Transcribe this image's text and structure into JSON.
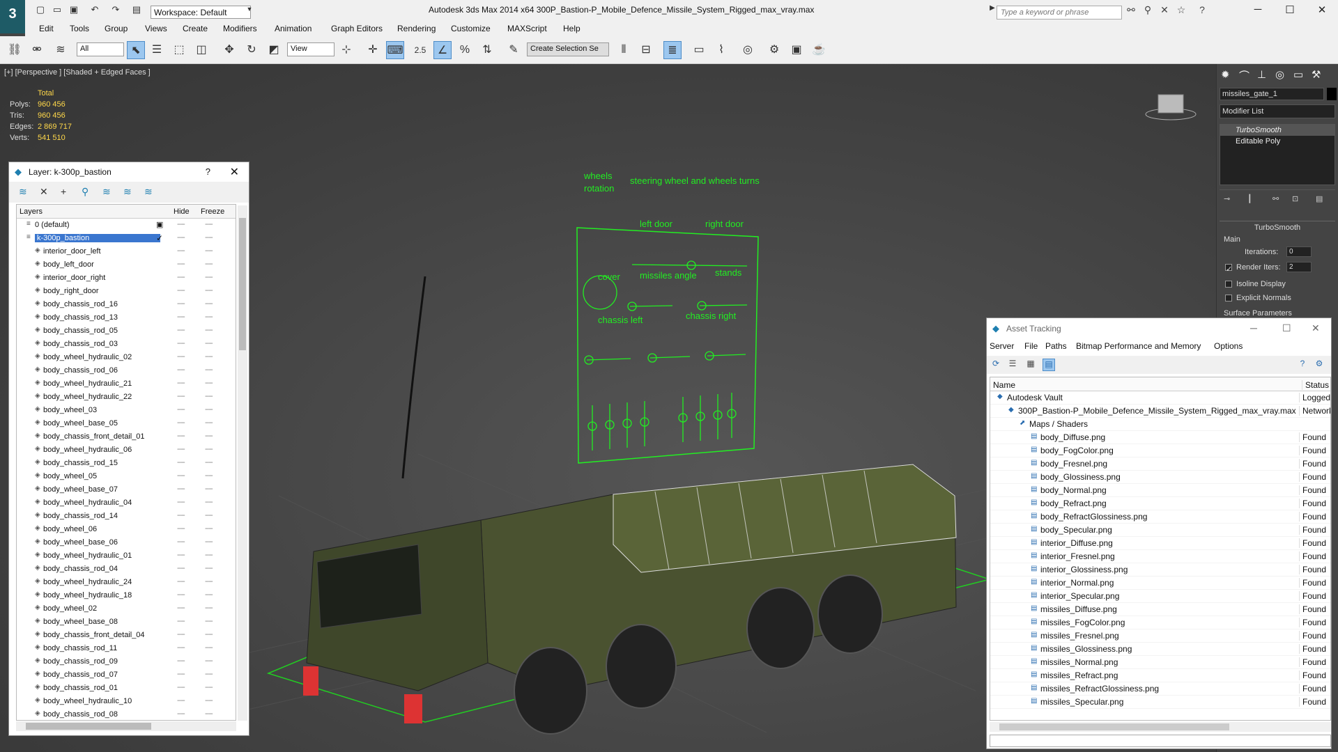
{
  "app": {
    "logo": "3",
    "title": "Autodesk 3ds Max  2014 x64     300P_Bastion-P_Mobile_Defence_Missile_System_Rigged_max_vray.max",
    "workspace": "Workspace: Default",
    "search_placeholder": "Type a keyword or phrase"
  },
  "menu": [
    "Edit",
    "Tools",
    "Group",
    "Views",
    "Create",
    "Modifiers",
    "Animation",
    "Graph Editors",
    "Rendering",
    "Customize",
    "MAXScript",
    "Help"
  ],
  "toolbar": {
    "filter": "All",
    "ref_coord": "View",
    "snap_label": "2.5",
    "named_sel": "Create Selection Se"
  },
  "viewport": {
    "label": "[+] [Perspective ] [Shaded + Edged Faces ]",
    "stats": {
      "header": "Total",
      "rows": [
        {
          "label": "Polys:",
          "value": "960 456"
        },
        {
          "label": "Tris:",
          "value": "960 456"
        },
        {
          "label": "Edges:",
          "value": "2 869 717"
        },
        {
          "label": "Verts:",
          "value": "541 510"
        }
      ]
    },
    "panel_labels": {
      "wheels_rotation": "wheels rotation",
      "steering": "steering wheel and wheels turns",
      "left_door": "left door",
      "right_door": "right door",
      "cover": "cover",
      "missiles_angle": "missiles angle",
      "stands": "stands",
      "chassis_left": "chassis left",
      "chassis_right": "chassis right"
    }
  },
  "layer_window": {
    "title": "Layer: k-300p_bastion",
    "help": "?",
    "col_layers": "Layers",
    "col_hide": "Hide",
    "col_freeze": "Freeze",
    "rows": [
      {
        "name": "0 (default)",
        "level": 0
      },
      {
        "name": "k-300p_bastion",
        "level": 0,
        "selected": true
      },
      {
        "name": "interior_door_left",
        "level": 1
      },
      {
        "name": "body_left_door",
        "level": 1
      },
      {
        "name": "interior_door_right",
        "level": 1
      },
      {
        "name": "body_right_door",
        "level": 1
      },
      {
        "name": "body_chassis_rod_16",
        "level": 1
      },
      {
        "name": "body_chassis_rod_13",
        "level": 1
      },
      {
        "name": "body_chassis_rod_05",
        "level": 1
      },
      {
        "name": "body_chassis_rod_03",
        "level": 1
      },
      {
        "name": "body_wheel_hydraulic_02",
        "level": 1
      },
      {
        "name": "body_chassis_rod_06",
        "level": 1
      },
      {
        "name": "body_wheel_hydraulic_21",
        "level": 1
      },
      {
        "name": "body_wheel_hydraulic_22",
        "level": 1
      },
      {
        "name": "body_wheel_03",
        "level": 1
      },
      {
        "name": "body_wheel_base_05",
        "level": 1
      },
      {
        "name": "body_chassis_front_detail_01",
        "level": 1
      },
      {
        "name": "body_wheel_hydraulic_06",
        "level": 1
      },
      {
        "name": "body_chassis_rod_15",
        "level": 1
      },
      {
        "name": "body_wheel_05",
        "level": 1
      },
      {
        "name": "body_wheel_base_07",
        "level": 1
      },
      {
        "name": "body_wheel_hydraulic_04",
        "level": 1
      },
      {
        "name": "body_chassis_rod_14",
        "level": 1
      },
      {
        "name": "body_wheel_06",
        "level": 1
      },
      {
        "name": "body_wheel_base_06",
        "level": 1
      },
      {
        "name": "body_wheel_hydraulic_01",
        "level": 1
      },
      {
        "name": "body_chassis_rod_04",
        "level": 1
      },
      {
        "name": "body_wheel_hydraulic_24",
        "level": 1
      },
      {
        "name": "body_wheel_hydraulic_18",
        "level": 1
      },
      {
        "name": "body_wheel_02",
        "level": 1
      },
      {
        "name": "body_wheel_base_08",
        "level": 1
      },
      {
        "name": "body_chassis_front_detail_04",
        "level": 1
      },
      {
        "name": "body_chassis_rod_11",
        "level": 1
      },
      {
        "name": "body_chassis_rod_09",
        "level": 1
      },
      {
        "name": "body_chassis_rod_07",
        "level": 1
      },
      {
        "name": "body_chassis_rod_01",
        "level": 1
      },
      {
        "name": "body_wheel_hydraulic_10",
        "level": 1
      },
      {
        "name": "body_chassis_rod_08",
        "level": 1
      }
    ]
  },
  "command_panel": {
    "object_name": "missiles_gate_1",
    "modifier_list": "Modifier List",
    "stack": [
      "TurboSmooth",
      "Editable Poly"
    ],
    "rollout": "TurboSmooth",
    "group_main": "Main",
    "iterations_label": "Iterations:",
    "iterations": "0",
    "render_iters_label": "Render Iters:",
    "render_iters": "2",
    "isoline": "Isoline Display",
    "explicit": "Explicit Normals",
    "surface": "Surface Parameters"
  },
  "asset_window": {
    "title": "Asset Tracking",
    "menu": [
      "Server",
      "File",
      "Paths",
      "Bitmap Performance and Memory",
      "Options"
    ],
    "col_name": "Name",
    "col_status": "Status",
    "rows": [
      {
        "name": "Autodesk Vault",
        "status": "Logged Out",
        "level": 0
      },
      {
        "name": "300P_Bastion-P_Mobile_Defence_Missile_System_Rigged_max_vray.max",
        "status": "Network",
        "level": 1
      },
      {
        "name": "Maps / Shaders",
        "status": "",
        "level": 2
      },
      {
        "name": "body_Diffuse.png",
        "status": "Found",
        "level": 3
      },
      {
        "name": "body_FogColor.png",
        "status": "Found",
        "level": 3
      },
      {
        "name": "body_Fresnel.png",
        "status": "Found",
        "level": 3
      },
      {
        "name": "body_Glossiness.png",
        "status": "Found",
        "level": 3
      },
      {
        "name": "body_Normal.png",
        "status": "Found",
        "level": 3
      },
      {
        "name": "body_Refract.png",
        "status": "Found",
        "level": 3
      },
      {
        "name": "body_RefractGlossiness.png",
        "status": "Found",
        "level": 3
      },
      {
        "name": "body_Specular.png",
        "status": "Found",
        "level": 3
      },
      {
        "name": "interior_Diffuse.png",
        "status": "Found",
        "level": 3
      },
      {
        "name": "interior_Fresnel.png",
        "status": "Found",
        "level": 3
      },
      {
        "name": "interior_Glossiness.png",
        "status": "Found",
        "level": 3
      },
      {
        "name": "interior_Normal.png",
        "status": "Found",
        "level": 3
      },
      {
        "name": "interior_Specular.png",
        "status": "Found",
        "level": 3
      },
      {
        "name": "missiles_Diffuse.png",
        "status": "Found",
        "level": 3
      },
      {
        "name": "missiles_FogColor.png",
        "status": "Found",
        "level": 3
      },
      {
        "name": "missiles_Fresnel.png",
        "status": "Found",
        "level": 3
      },
      {
        "name": "missiles_Glossiness.png",
        "status": "Found",
        "level": 3
      },
      {
        "name": "missiles_Normal.png",
        "status": "Found",
        "level": 3
      },
      {
        "name": "missiles_Refract.png",
        "status": "Found",
        "level": 3
      },
      {
        "name": "missiles_RefractGlossiness.png",
        "status": "Found",
        "level": 3
      },
      {
        "name": "missiles_Specular.png",
        "status": "Found",
        "level": 3
      }
    ]
  },
  "colors": {
    "rig_green": "#22ee22",
    "stats_yellow": "#ffd84a",
    "selection_blue": "#3a76cf"
  }
}
